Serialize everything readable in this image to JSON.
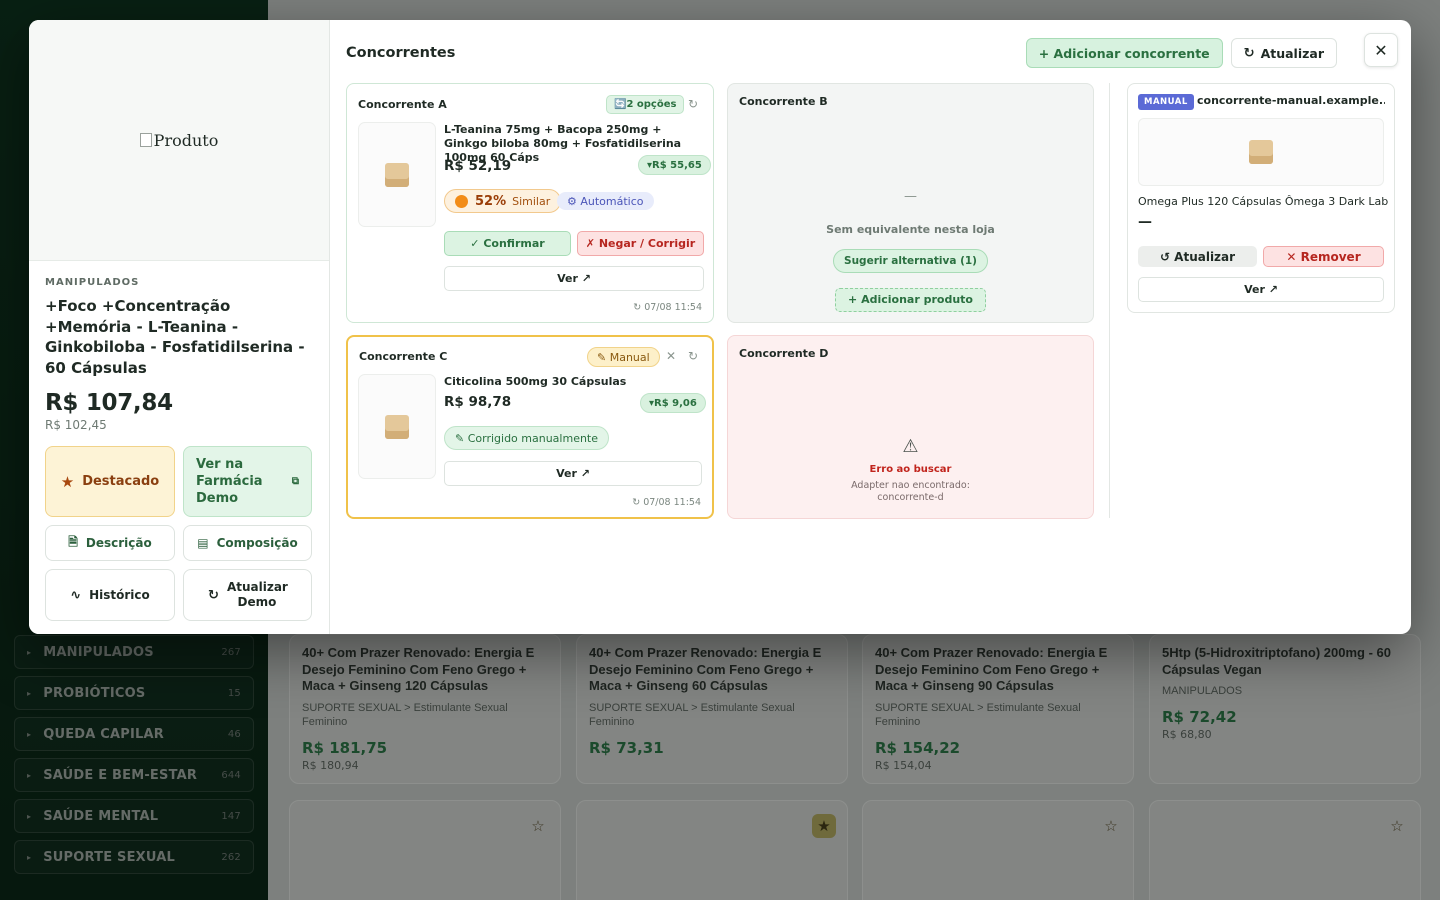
{
  "background": {
    "sidebar_categories": [
      {
        "label": "MANIPULADOS",
        "count": "267"
      },
      {
        "label": "PROBIÓTICOS",
        "count": "15"
      },
      {
        "label": "QUEDA CAPILAR",
        "count": "46"
      },
      {
        "label": "SAÚDE E BEM-ESTAR",
        "count": "644"
      },
      {
        "label": "SAÚDE MENTAL",
        "count": "147"
      },
      {
        "label": "SUPORTE SEXUAL",
        "count": "262"
      }
    ],
    "cards": [
      {
        "title": "40+ Com Prazer Renovado: Energia E Desejo Feminino Com Feno Grego + Maca + Ginseng 120 Cápsulas",
        "category": "SUPORTE SEXUAL > Estimulante Sexual Feminino",
        "price": "R$ 181,75",
        "old_price": "R$ 180,94"
      },
      {
        "title": "40+ Com Prazer Renovado: Energia E Desejo Feminino Com Feno Grego + Maca + Ginseng 60 Cápsulas",
        "category": "SUPORTE SEXUAL > Estimulante Sexual Feminino",
        "price": "R$ 73,31",
        "old_price": ""
      },
      {
        "title": "40+ Com Prazer Renovado: Energia E Desejo Feminino Com Feno Grego + Maca + Ginseng 90 Cápsulas",
        "category": "SUPORTE SEXUAL > Estimulante Sexual Feminino",
        "price": "R$ 154,22",
        "old_price": "R$ 154,04"
      },
      {
        "title": "5Htp (5-Hidroxitriptofano) 200mg - 60 Cápsulas Vegan",
        "category": "MANIPULADOS",
        "price": "R$ 72,42",
        "old_price": "R$ 68,80"
      }
    ]
  },
  "product": {
    "image_alt": "Produto",
    "category": "MANIPULADOS",
    "title": "+Foco +Concentração +Memória - L-Teanina - Ginkobiloba - Fosfatidilserina - 60 Cápsulas",
    "price": "R$ 107,84",
    "old_price": "R$ 102,45",
    "buttons": {
      "featured": "Destacado",
      "view_store": "Ver na Farmácia Demo",
      "description": "Descrição",
      "composition": "Composição",
      "history": "Histórico",
      "refresh_demo": "Atualizar Demo"
    }
  },
  "competitors_panel": {
    "title": "Concorrentes",
    "add_label": "+ Adicionar concorrente",
    "refresh_label": "Atualizar",
    "close_glyph": "✕"
  },
  "competitors": {
    "a": {
      "name": "Concorrente A",
      "options_badge": "🔄2 opções",
      "product_title": "L-Teanina 75mg + Bacopa 250mg + Ginkgo biloba 80mg + Fosfatidilserina 100mg 60 Cáps",
      "price": "R$ 52,19",
      "diff": "▾R$ 55,65",
      "similarity_pct": "52%",
      "similarity_label": "Similar",
      "match_type": "⚙ Automático",
      "confirm": "✓ Confirmar",
      "deny": "✗ Negar / Corrigir",
      "view": "Ver ↗",
      "timestamp": "↻ 07/08 11:54"
    },
    "b": {
      "name": "Concorrente B",
      "dash": "—",
      "empty_text": "Sem equivalente nesta loja",
      "suggest": "Sugerir alternativa (1)",
      "add_product": "+ Adicionar produto"
    },
    "c": {
      "name": "Concorrente C",
      "manual_badge": "✎ Manual",
      "product_title": "Citicolina 500mg 30 Cápsulas",
      "price": "R$ 98,78",
      "diff": "▾R$ 9,06",
      "corrected": "✎ Corrigido manualmente",
      "view": "Ver ↗",
      "timestamp": "↻ 07/08 11:54"
    },
    "d": {
      "name": "Concorrente D",
      "warning_glyph": "⚠",
      "error_title": "Erro ao buscar",
      "error_detail": "Adapter nao encontrado: concorrente-d"
    },
    "manual": {
      "tag": "MANUAL",
      "domain": "concorrente-manual.example....",
      "product_title": "Omega Plus 120 Cápsulas Ômega 3 Dark Lab",
      "price": "—",
      "refresh": "↺ Atualizar",
      "remove": "✕ Remover",
      "view": "Ver ↗"
    }
  },
  "colors": {
    "accent_green": "#2a7040",
    "warning_orange": "#f28c18",
    "error_red": "#b6261f",
    "manual_blue": "#5b6ad6"
  }
}
